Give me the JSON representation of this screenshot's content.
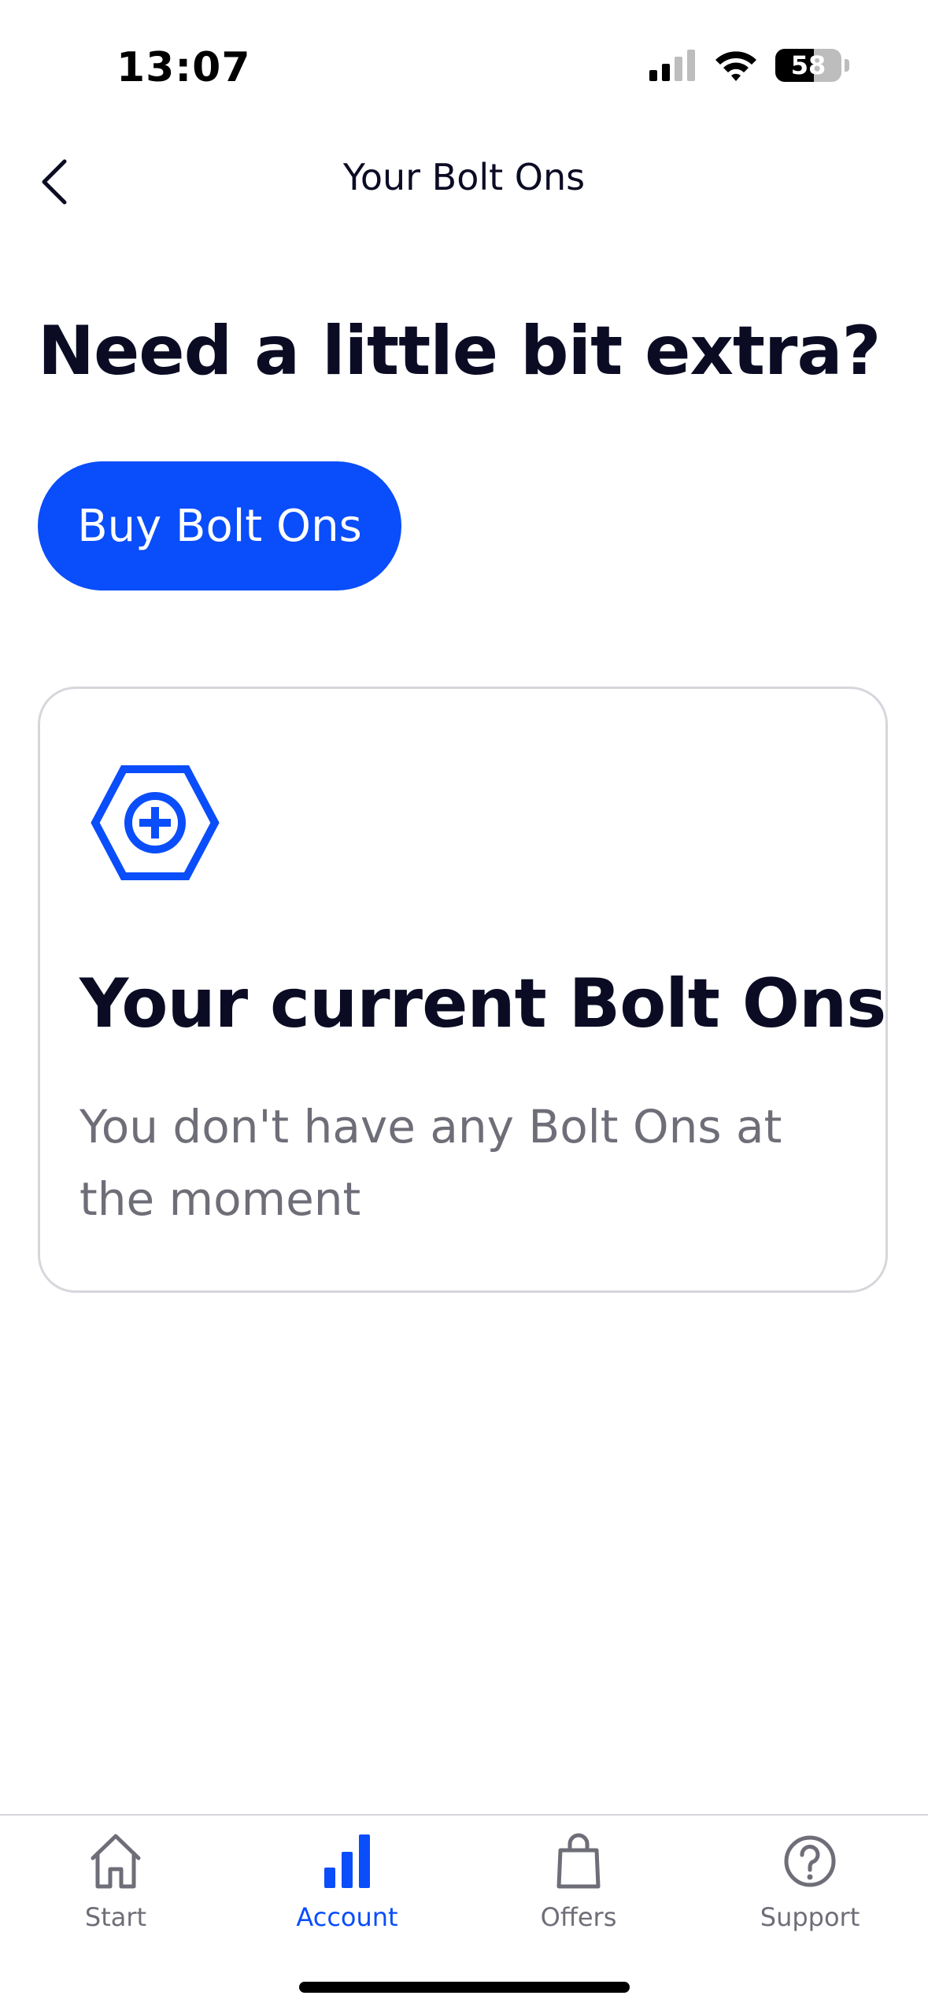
{
  "status": {
    "time": "13:07",
    "battery": "58",
    "battery_level": 0.58
  },
  "header": {
    "title": "Your Bolt Ons",
    "back_icon": "chevron-left-icon"
  },
  "main": {
    "heading": "Need a little bit extra?",
    "buy_label": "Buy Bolt Ons",
    "card": {
      "icon": "hexagon-plus-icon",
      "title": "Your current Bolt Ons",
      "text": "You don't have any Bolt Ons at the moment"
    }
  },
  "tabs": [
    {
      "label": "Start",
      "icon": "home-icon",
      "active": false
    },
    {
      "label": "Account",
      "icon": "bar-chart-icon",
      "active": true
    },
    {
      "label": "Offers",
      "icon": "shopping-bag-icon",
      "active": false
    },
    {
      "label": "Support",
      "icon": "question-circle-icon",
      "active": false
    }
  ],
  "colors": {
    "accent": "#0a4dfa",
    "text": "#0b0c24",
    "muted": "#6e6e78",
    "border": "#d6d6dc"
  }
}
